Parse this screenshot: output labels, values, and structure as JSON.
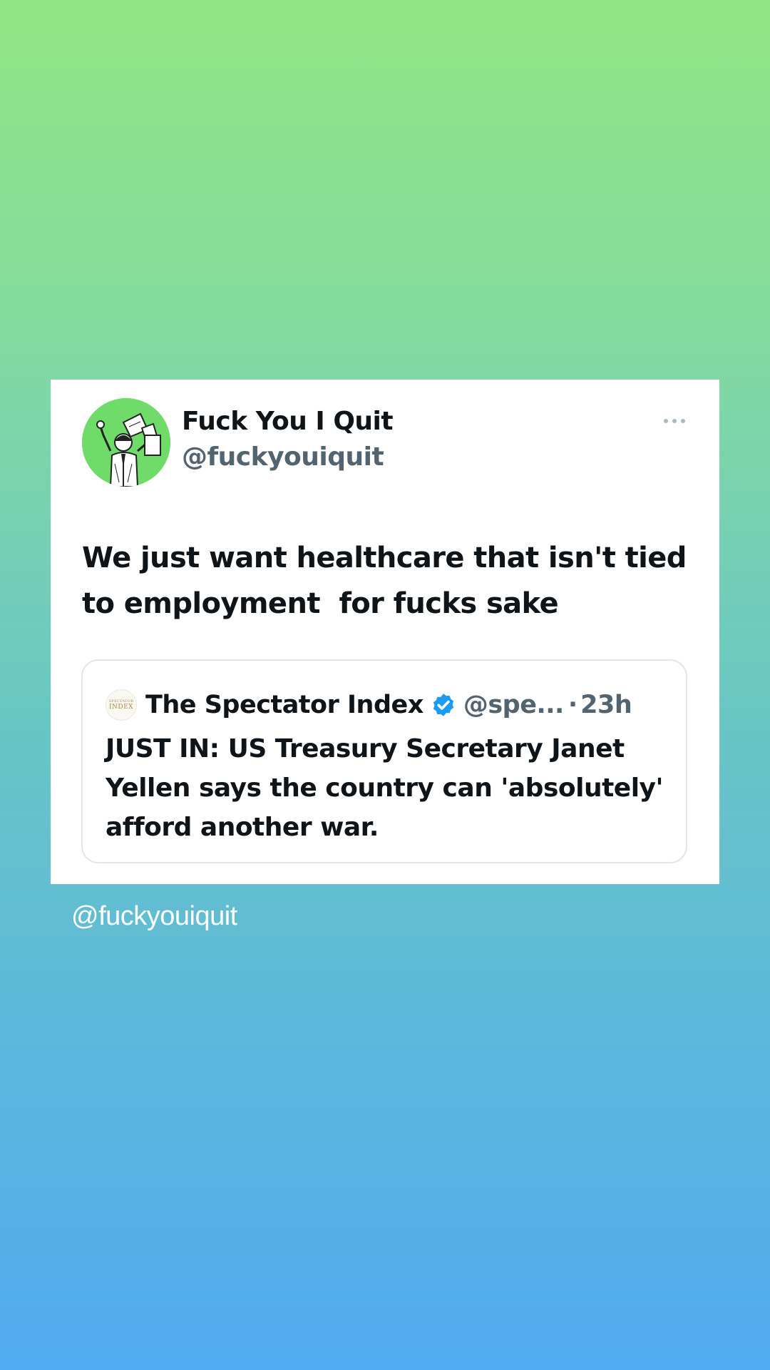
{
  "tweet": {
    "display_name": "Fuck You I Quit",
    "handle": "@fuckyouiquit",
    "avatar_icon": "man-throwing-papers-avatar",
    "avatar_bg": "#6fdc6a",
    "text": "We just want healthcare that isn't tied to employment  for fucks sake",
    "more_icon": "more-horizontal-icon"
  },
  "quoted": {
    "logo_text_top": "SPECTATOR",
    "logo_text_bottom": "INDEX",
    "display_name": "The Spectator Index",
    "verified_icon": "verified-badge-icon",
    "verified_color": "#1d9bf0",
    "handle": "@spe...",
    "separator": "·",
    "time": "23h",
    "text": "JUST IN: US Treasury Secretary Janet Yellen says the country can 'absolutely' afford another war."
  },
  "watermark": "@fuckyouiquit",
  "colors": {
    "gradient_top": "#92e584",
    "gradient_bottom": "#52aaf0",
    "text_primary": "#0f1419",
    "text_secondary": "#536471"
  }
}
